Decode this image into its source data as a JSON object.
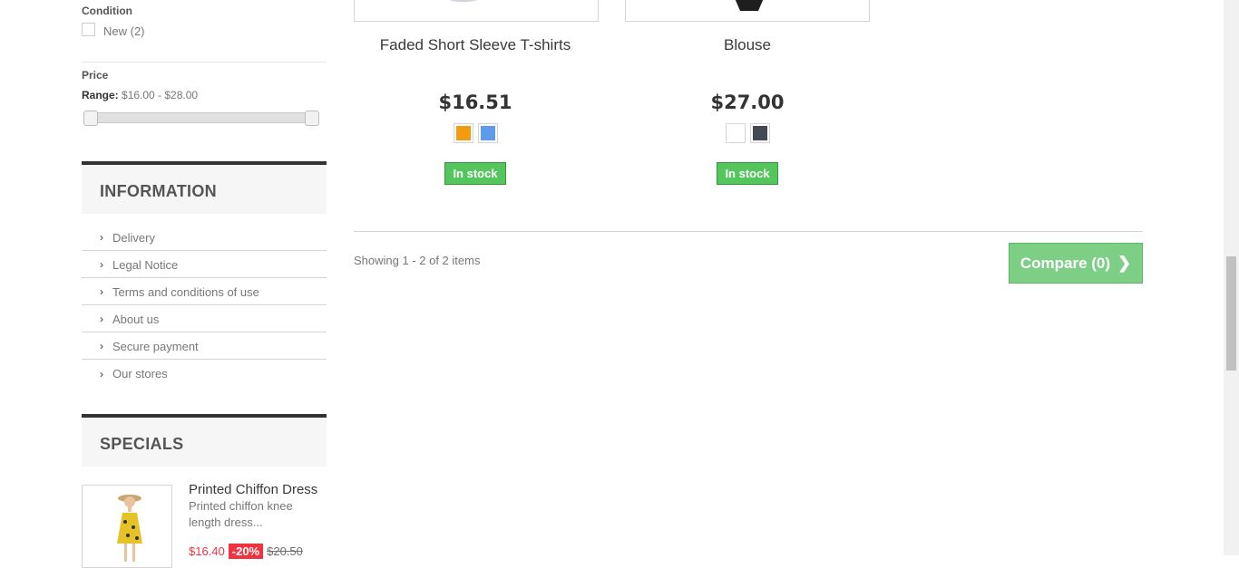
{
  "filters": {
    "condition": {
      "title": "Condition",
      "options": [
        {
          "label": "New (2)"
        }
      ]
    },
    "price": {
      "title": "Price",
      "range_label": "Range:",
      "range_value": "$16.00 - $28.00"
    }
  },
  "information": {
    "title": "INFORMATION",
    "links": [
      "Delivery",
      "Legal Notice",
      "Terms and conditions of use",
      "About us",
      "Secure payment",
      "Our stores"
    ]
  },
  "specials": {
    "title": "SPECIALS",
    "item": {
      "name": "Printed Chiffon Dress",
      "description": "Printed chiffon knee length dress...",
      "price": "$16.40",
      "discount": "-20%",
      "old_price": "$20.50"
    }
  },
  "products": [
    {
      "name": "Faded Short Sleeve T-shirts",
      "price": "$16.51",
      "colors": [
        "#f39c11",
        "#5d9cec"
      ],
      "availability": "In stock"
    },
    {
      "name": "Blouse",
      "price": "$27.00",
      "colors": [
        "#ffffff",
        "#434a54"
      ],
      "availability": "In stock"
    }
  ],
  "pagination": {
    "showing": "Showing 1 - 2 of 2 items"
  },
  "compare": {
    "label": "Compare (0)"
  }
}
